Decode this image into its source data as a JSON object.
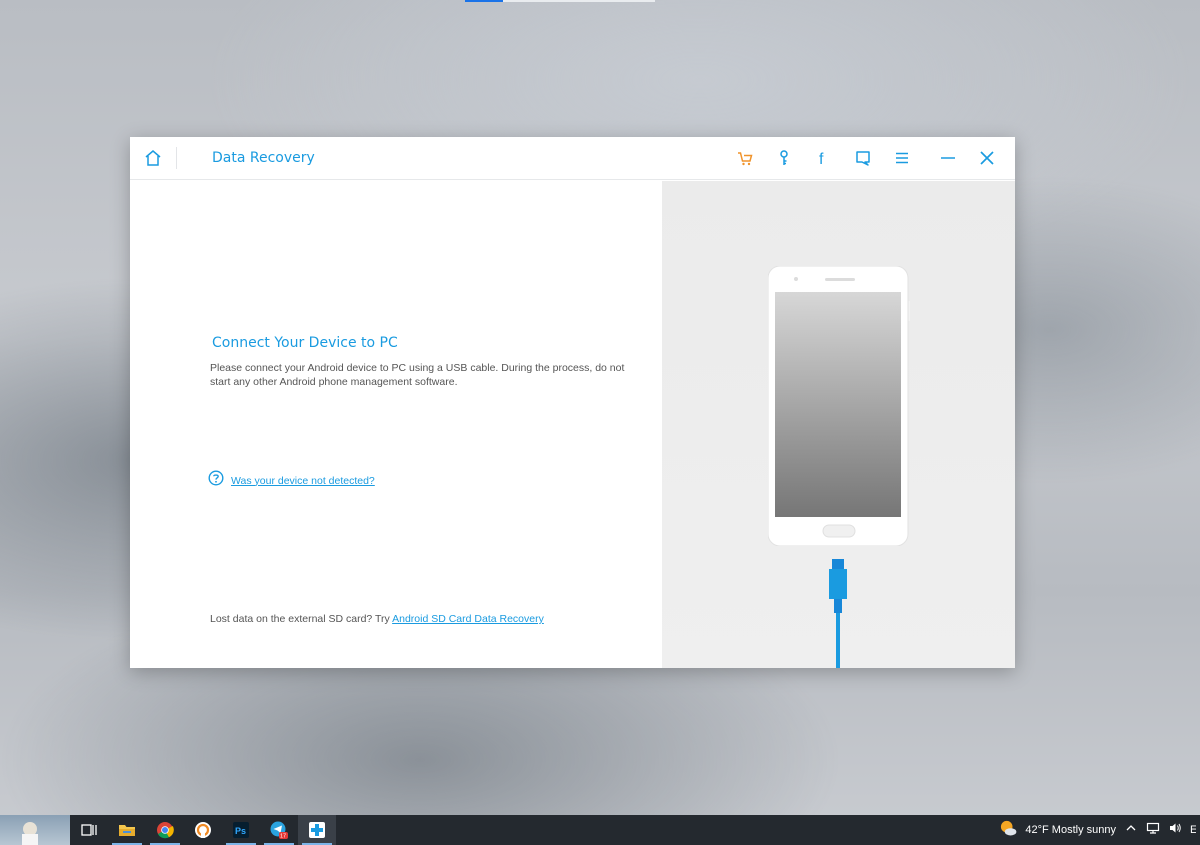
{
  "app": {
    "title": "Data Recovery",
    "accent_color": "#1a9be0",
    "cart_color": "#f0932b"
  },
  "toolbar": {
    "icons": [
      "home-icon",
      "cart-icon",
      "key-icon",
      "facebook-icon",
      "feedback-icon",
      "menu-icon",
      "minimize-icon",
      "close-icon"
    ],
    "facebook_glyph": "f"
  },
  "main": {
    "heading": "Connect Your Device to PC",
    "description": "Please connect your Android device to PC using a USB cable. During the process, do not start any other Android phone management software.",
    "help_link": "Was your device not detected?",
    "sd_prefix": "Lost data on the external SD card? Try ",
    "sd_link": "Android SD Card Data Recovery"
  },
  "taskbar": {
    "apps": [
      "task-view-icon",
      "file-explorer-icon",
      "chrome-icon",
      "ring-app-icon",
      "photoshop-icon",
      "telegram-icon",
      "data-recovery-icon"
    ],
    "photoshop_label": "Ps",
    "telegram_badge": "17",
    "weather": "42°F  Mostly sunny",
    "cut_letter": "E"
  }
}
